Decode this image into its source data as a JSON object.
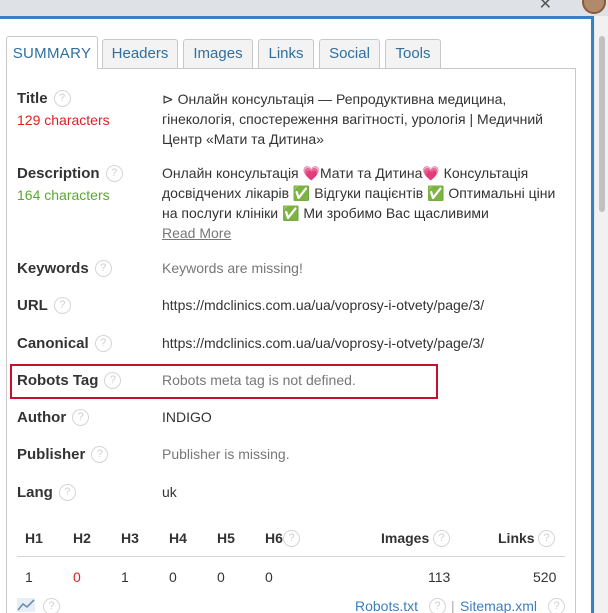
{
  "tabs": [
    {
      "label": "SUMMARY",
      "active": true
    },
    {
      "label": "Headers",
      "active": false
    },
    {
      "label": "Images",
      "active": false
    },
    {
      "label": "Links",
      "active": false
    },
    {
      "label": "Social",
      "active": false
    },
    {
      "label": "Tools",
      "active": false
    }
  ],
  "help_glyph": "?",
  "title": {
    "label": "Title",
    "count": "129 characters",
    "value": "⊳ Онлайн консультація — Репродуктивна медицина, гінекологія, спостереження вагітності, урологія | Медичний Центр «Мати та Дитина»"
  },
  "description": {
    "label": "Description",
    "count": "164 characters",
    "value": "Онлайн консультація 💗Мати та Дитина💗 Консультація досвідчених лікарів ✅ Відгуки пацієнтів ✅ Оптимальні ціни на послуги клініки ✅ Ми зробимо Вас щасливими",
    "read_more": "Read More"
  },
  "keywords": {
    "label": "Keywords",
    "value": "Keywords are missing!"
  },
  "url": {
    "label": "URL",
    "value": "https://mdclinics.com.ua/ua/voprosy-i-otvety/page/3/"
  },
  "canonical": {
    "label": "Canonical",
    "value": "https://mdclinics.com.ua/ua/voprosy-i-otvety/page/3/"
  },
  "robots": {
    "label": "Robots Tag",
    "value": "Robots meta tag is not defined."
  },
  "author": {
    "label": "Author",
    "value": "INDIGO"
  },
  "publisher": {
    "label": "Publisher",
    "value": "Publisher is missing."
  },
  "lang": {
    "label": "Lang",
    "value": "uk"
  },
  "stats": {
    "headers": [
      "H1",
      "H2",
      "H3",
      "H4",
      "H5",
      "H6"
    ],
    "header_values": [
      "1",
      "0",
      "1",
      "0",
      "0",
      "0"
    ],
    "images_label": "Images",
    "images_value": "113",
    "links_label": "Links",
    "links_value": "520"
  },
  "footer": {
    "robots_link": "Robots.txt",
    "separator": "|",
    "sitemap_link": "Sitemap.xml"
  },
  "colors": {
    "accent": "#3b7fbf",
    "warning": "#dd2222",
    "ok": "#5aa832",
    "highlight_border": "#c8102e"
  }
}
